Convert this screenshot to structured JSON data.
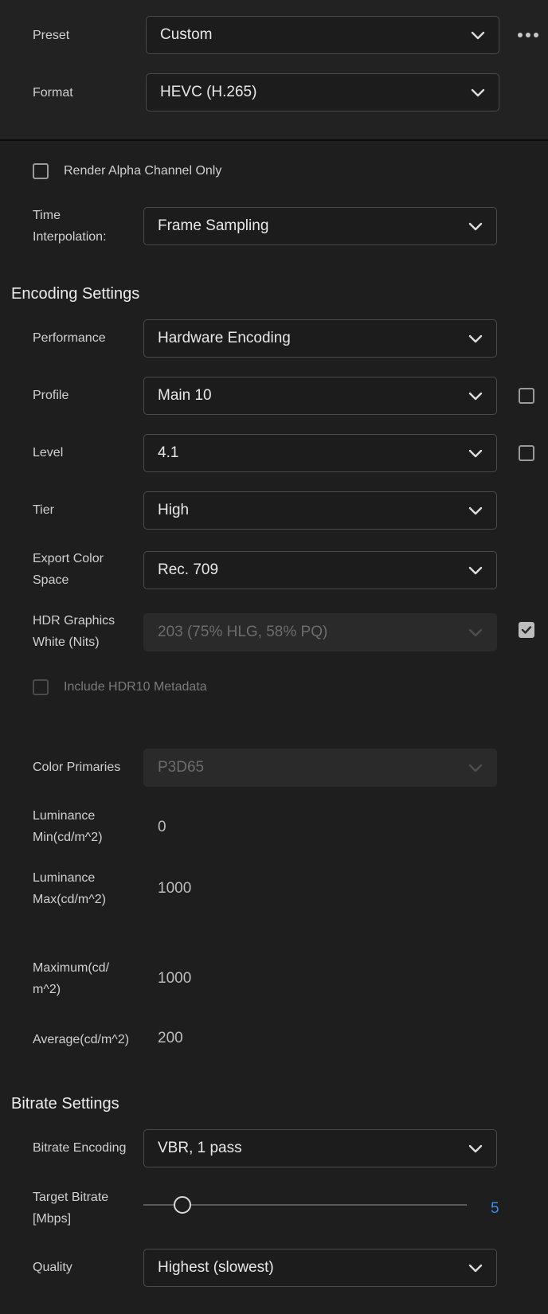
{
  "top": {
    "preset_label": "Preset",
    "preset_value": "Custom",
    "format_label": "Format",
    "format_value": "HEVC (H.265)",
    "more_icon": "more-horizontal-icon"
  },
  "general": {
    "render_alpha_label": "Render Alpha Channel Only",
    "render_alpha_checked": false,
    "time_interp_label_line1": "Time",
    "time_interp_label_line2": "Interpolation:",
    "time_interp_value": "Frame Sampling"
  },
  "encoding": {
    "title": "Encoding Settings",
    "performance_label": "Performance",
    "performance_value": "Hardware Encoding",
    "profile_label": "Profile",
    "profile_value": "Main 10",
    "profile_checked": false,
    "level_label": "Level",
    "level_value": "4.1",
    "level_checked": false,
    "tier_label": "Tier",
    "tier_value": "High",
    "color_space_label_line1": "Export Color",
    "color_space_label_line2": "Space",
    "color_space_value": "Rec. 709",
    "hdr_white_label_line1": "HDR Graphics",
    "hdr_white_label_line2": "White (Nits)",
    "hdr_white_value": "203 (75% HLG, 58% PQ)",
    "hdr_white_checked": true,
    "include_hdr10_label": "Include HDR10 Metadata",
    "include_hdr10_checked": false,
    "color_primaries_label": "Color Primaries",
    "color_primaries_value": "P3D65",
    "lum_min_label_line1": "Luminance",
    "lum_min_label_line2": "Min(cd/m^2)",
    "lum_min_value": "0",
    "lum_max_label_line1": "Luminance",
    "lum_max_label_line2": "Max(cd/m^2)",
    "lum_max_value": "1000",
    "maximum_label_line1": "Maximum(cd/",
    "maximum_label_line2": "m^2)",
    "maximum_value": "1000",
    "average_label": "Average(cd/m^2)",
    "average_value": "200"
  },
  "bitrate": {
    "title": "Bitrate Settings",
    "encoding_label": "Bitrate Encoding",
    "encoding_value": "VBR, 1 pass",
    "target_label_line1": "Target Bitrate",
    "target_label_line2": "[Mbps]",
    "target_value": "5",
    "target_slider_fraction": 0.1,
    "quality_label": "Quality",
    "quality_value": "Highest (slowest)"
  },
  "colors": {
    "background": "#1e1e1e",
    "accent_blue": "#3b8eea"
  }
}
